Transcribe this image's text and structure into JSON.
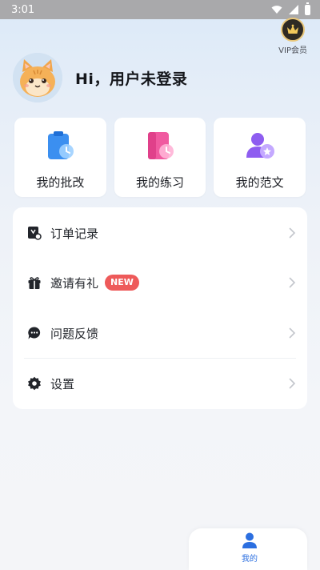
{
  "status_bar": {
    "time": "3:01"
  },
  "vip": {
    "label": "VIP会员"
  },
  "profile": {
    "greeting": "Hi，用户未登录"
  },
  "quick_actions": [
    {
      "label": "我的批改",
      "icon": "clipboard-clock-icon",
      "color": "#3b8ff0"
    },
    {
      "label": "我的练习",
      "icon": "document-clock-icon",
      "color": "#f05aa0"
    },
    {
      "label": "我的范文",
      "icon": "user-star-icon",
      "color": "#8e5df0"
    }
  ],
  "menu": [
    {
      "label": "订单记录",
      "icon": "order-icon"
    },
    {
      "label": "邀请有礼",
      "icon": "gift-icon",
      "badge": "NEW"
    },
    {
      "label": "问题反馈",
      "icon": "chat-icon"
    },
    {
      "label": "设置",
      "icon": "gear-icon"
    }
  ],
  "bottom_nav": {
    "me_label": "我的",
    "active_color": "#2c6fe0"
  },
  "colors": {
    "badge_new": "#ee5a5a",
    "vip_gold": "#e9c77a"
  }
}
